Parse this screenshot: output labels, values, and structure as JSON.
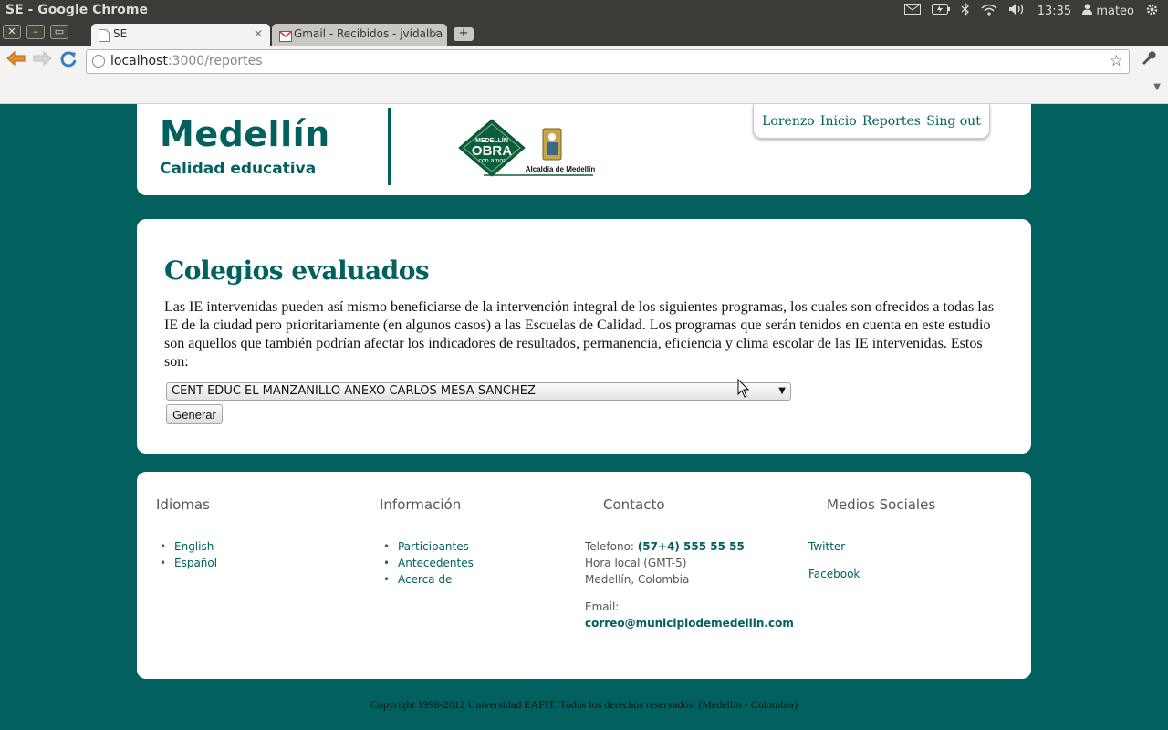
{
  "os": {
    "window_title": "SE - Google Chrome",
    "time": "13:35",
    "user": "mateo"
  },
  "browser": {
    "tabs": [
      {
        "label": "SE"
      },
      {
        "label": "Gmail - Recibidos - jvidalba"
      }
    ],
    "url_host": "localhost",
    "url_path": ":3000/reportes"
  },
  "header": {
    "brand_title": "Medellín",
    "brand_subtitle": "Calidad educativa",
    "logo": {
      "line1": "MEDELLÍN",
      "line2": "OBRA",
      "line3": "con amor",
      "caption": "Alcaldía de Medellín"
    },
    "nav": [
      "Lorenzo",
      "Inicio",
      "Reportes",
      "Sing out"
    ]
  },
  "main": {
    "title": "Colegios evaluados",
    "description": "Las IE intervenidas pueden así mismo beneficiarse de la intervención integral de los siguientes programas, los cuales son ofrecidos a todas las IE de la ciudad pero prioritariamente (en algunos casos) a las Escuelas de Calidad. Los programas que serán tenidos en cuenta en este estudio son aquellos que también podrían afectar los indicadores de resultados, permanencia, eficiencia y clima escolar de las IE intervenidas. Estos son:",
    "select_value": "CENT EDUC EL MANZANILLO ANEXO CARLOS MESA SANCHEZ",
    "generate_label": "Generar"
  },
  "footer": {
    "idiomas": {
      "title": "Idiomas",
      "items": [
        "English",
        "Español"
      ]
    },
    "informacion": {
      "title": "Información",
      "items": [
        "Participantes",
        "Antecedentes",
        "Acerca de"
      ]
    },
    "contacto": {
      "title": "Contacto",
      "phone_label": "Telefono:",
      "phone": "(57+4) 555 55 55",
      "timezone": "Hora local (GMT-5)",
      "city": "Medellín, Colombia",
      "email_label": "Email:",
      "email": "correo@municipiodemedellin.com"
    },
    "social": {
      "title": "Medios Sociales",
      "items": [
        "Twitter",
        "Facebook"
      ]
    },
    "copyright": "Copyright 1998-2012 Universidad EAFIT. Todos los derechos reservados. (Medellin - Colombia)"
  },
  "colors": {
    "brand": "#02605f",
    "os_bar": "#3c3b37"
  }
}
